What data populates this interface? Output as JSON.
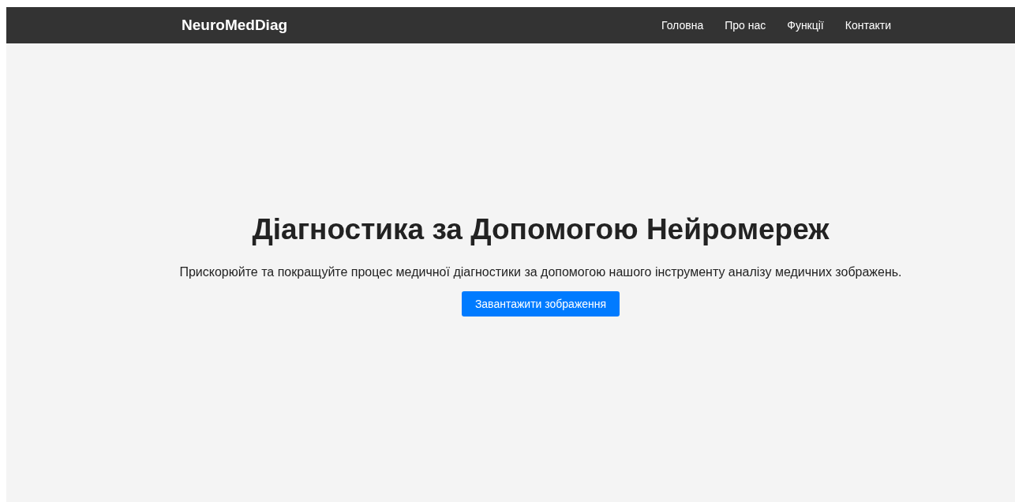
{
  "header": {
    "logo": "NeuroMedDiag",
    "nav": [
      {
        "label": "Головна"
      },
      {
        "label": "Про нас"
      },
      {
        "label": "Функції"
      },
      {
        "label": "Контакти"
      }
    ]
  },
  "hero": {
    "title": "Діагностика за Допомогою Нейромереж",
    "text": "Прискорюйте та покращуйте процес медичної діагностики за допомогою нашого інструменту аналізу медичних зображень.",
    "button": "Завантажити зображення"
  }
}
